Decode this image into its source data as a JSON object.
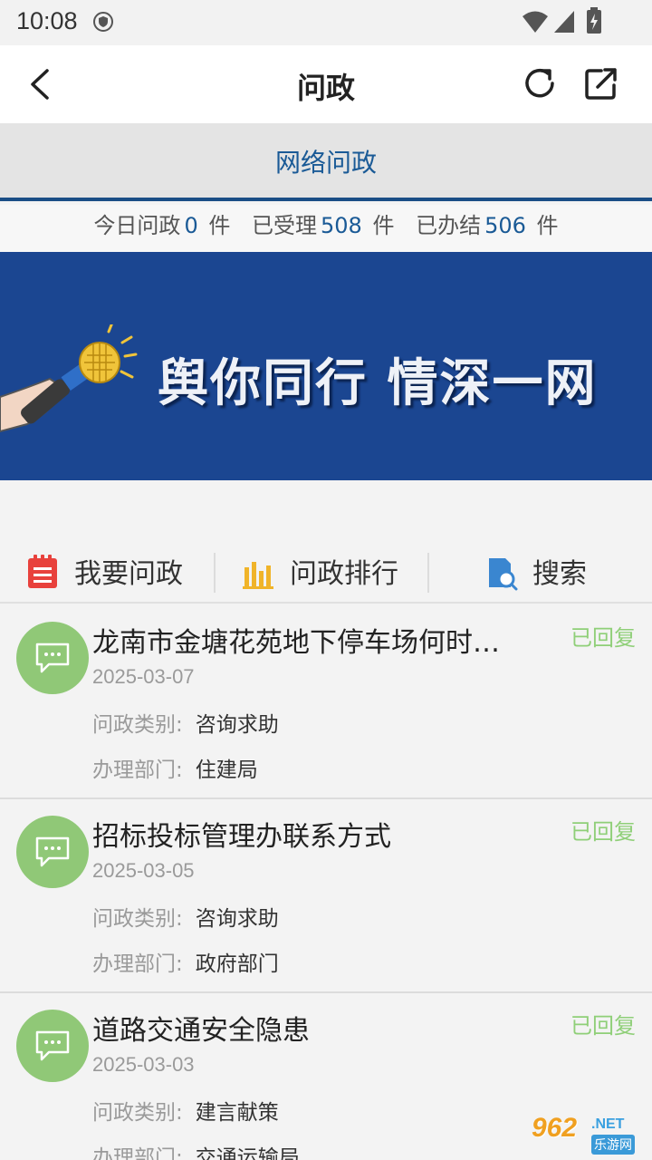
{
  "status_bar": {
    "time": "10:08"
  },
  "header": {
    "title": "问政"
  },
  "tab": {
    "title": "网络问政"
  },
  "stats": {
    "today_label": "今日问政",
    "today_count": "0",
    "accepted_label": "已受理",
    "accepted_count": "508",
    "resolved_label": "已办结",
    "resolved_count": "506",
    "unit": "件"
  },
  "banner": {
    "slogan": "舆你同行 情深一网"
  },
  "actions": [
    {
      "label": "我要问政",
      "icon": "form-icon"
    },
    {
      "label": "问政排行",
      "icon": "bar-chart-icon"
    },
    {
      "label": "搜索",
      "icon": "search-doc-icon"
    }
  ],
  "list": {
    "category_label": "问政类别:",
    "department_label": "办理部门:",
    "items": [
      {
        "title": "龙南市金塘花苑地下停车场何时开放",
        "status": "已回复",
        "date": "2025-03-07",
        "category": "咨询求助",
        "department": "住建局"
      },
      {
        "title": "招标投标管理办联系方式",
        "status": "已回复",
        "date": "2025-03-05",
        "category": "咨询求助",
        "department": "政府部门"
      },
      {
        "title": "道路交通安全隐患",
        "status": "已回复",
        "date": "2025-03-03",
        "category": "建言献策",
        "department": "交通运输局"
      }
    ]
  },
  "watermark": {
    "big": "962",
    "net": ".NET",
    "sub": "乐游网"
  },
  "colors": {
    "accent_blue": "#1a5a96",
    "banner_blue": "#1b4691",
    "reply_green": "#8fcf78",
    "avatar_green": "#90c877"
  }
}
